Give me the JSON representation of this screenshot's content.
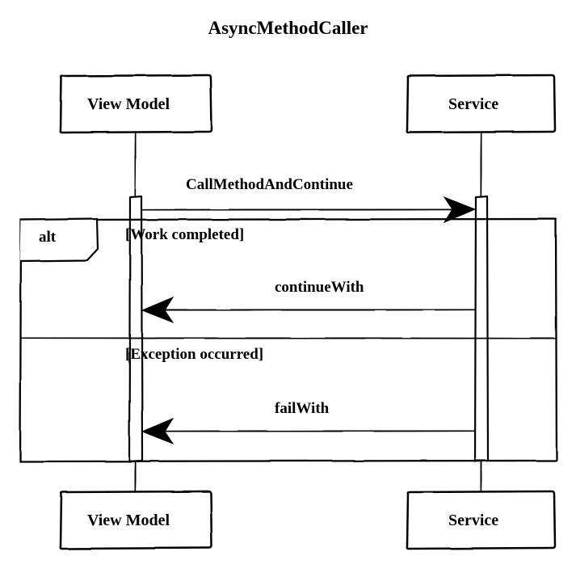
{
  "title": "AsyncMethodCaller",
  "participants": {
    "viewModel": "View Model",
    "service": "Service"
  },
  "messages": {
    "call": "CallMethodAndContinue",
    "continueWith": "continueWith",
    "failWith": "failWith"
  },
  "fragment": {
    "type": "alt",
    "guard1": "[Work completed]",
    "guard2": "[Exception occurred]"
  }
}
